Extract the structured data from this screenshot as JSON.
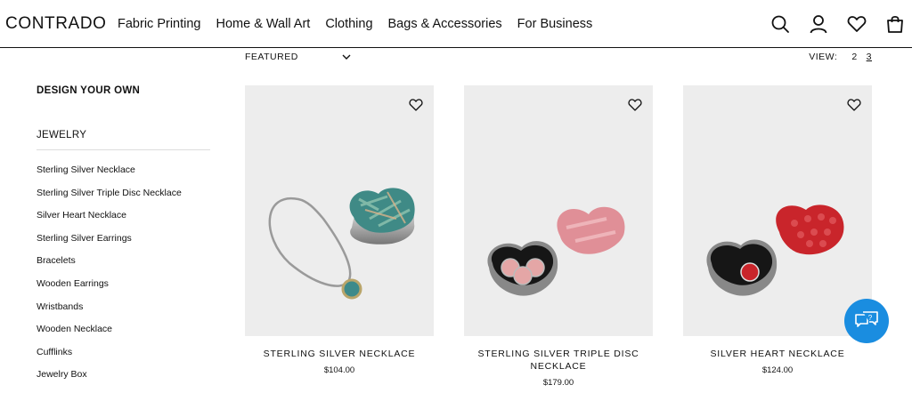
{
  "header": {
    "logo": "CONTRADO",
    "nav": [
      "Fabric Printing",
      "Home & Wall Art",
      "Clothing",
      "Bags & Accessories",
      "For Business"
    ],
    "icons": [
      "search-icon",
      "account-icon",
      "wishlist-icon",
      "bag-icon"
    ]
  },
  "sort": {
    "label": "FEATURED",
    "icon": "chevron-down-icon"
  },
  "view": {
    "label": "VIEW:",
    "options": [
      "2",
      "3"
    ],
    "active": "3"
  },
  "sidebar": {
    "design_heading": "DESIGN YOUR OWN",
    "category": "JEWELRY",
    "items": [
      "Sterling Silver Necklace",
      "Sterling Silver Triple Disc Necklace",
      "Silver Heart Necklace",
      "Sterling Silver Earrings",
      "Bracelets",
      "Wooden Earrings",
      "Wristbands",
      "Wooden Necklace",
      "Cufflinks",
      "Jewelry Box"
    ]
  },
  "products": [
    {
      "title": "STERLING SILVER NECKLACE",
      "price": "$104.00"
    },
    {
      "title": "STERLING SILVER TRIPLE DISC NECKLACE",
      "price": "$179.00"
    },
    {
      "title": "SILVER HEART NECKLACE",
      "price": "$124.00"
    }
  ],
  "colors": {
    "accent": "#1a8de0",
    "card_bg": "#ededed",
    "text": "#111111"
  },
  "chat": {
    "icon": "chat-help-icon"
  }
}
